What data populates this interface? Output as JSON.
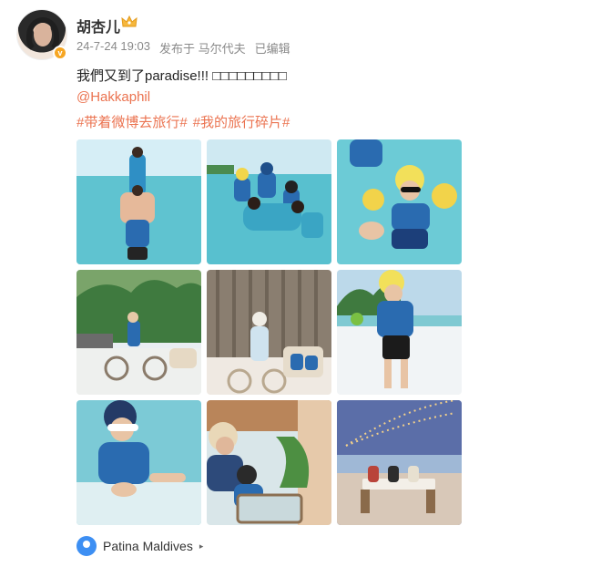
{
  "post": {
    "username": "胡杏儿",
    "verified_badge": "v",
    "timestamp": "24-7-24 19:03",
    "published_from": "发布于",
    "place": "马尔代夫",
    "edited": "已编辑",
    "text": "我們又到了paradise!!! □□□□□□□□□",
    "mention": "@Hakkaphil",
    "tags": [
      "#带着微博去旅行#",
      "#我的旅行碎片#"
    ],
    "location": "Patina Maldives",
    "location_arrow": "▸"
  },
  "icons": {
    "avatar": "user-avatar",
    "crown": "crown-icon",
    "location": "location-pin-icon"
  },
  "colors": {
    "link": "#eb7350",
    "meta": "#8a8a8a",
    "pin": "#3d8ff3",
    "badge": "#f6a623"
  },
  "photos": [
    {
      "scene": "beach-family-stack"
    },
    {
      "scene": "family-in-water"
    },
    {
      "scene": "child-with-floaties"
    },
    {
      "scene": "bike-by-palms"
    },
    {
      "scene": "bike-with-trailer"
    },
    {
      "scene": "child-on-beach"
    },
    {
      "scene": "child-in-water-sunglasses"
    },
    {
      "scene": "family-dining"
    },
    {
      "scene": "sunset-dinner-lights"
    }
  ]
}
